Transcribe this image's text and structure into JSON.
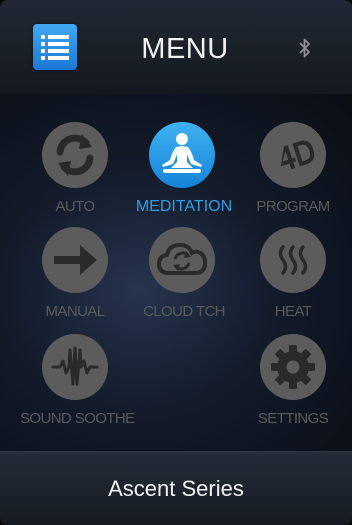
{
  "header": {
    "title": "MENU",
    "menu_icon": "list-menu-icon",
    "status_icon": "bluetooth-icon"
  },
  "menu": {
    "items": [
      {
        "label": "AUTO",
        "icon": "auto-sync-icon",
        "active": false
      },
      {
        "label": "MEDITATION",
        "icon": "meditation-icon",
        "active": true
      },
      {
        "label": "PROGRAM",
        "icon": "4d-program-icon",
        "active": false
      },
      {
        "label": "MANUAL",
        "icon": "arrow-right-icon",
        "active": false
      },
      {
        "label": "CLOUD TCH",
        "icon": "cloud-sync-icon",
        "active": false
      },
      {
        "label": "HEAT",
        "icon": "heat-waves-icon",
        "active": false
      },
      {
        "label": "SOUND SOOTHE",
        "icon": "sound-wave-icon",
        "active": false
      },
      {
        "label": "SETTINGS",
        "icon": "gear-icon",
        "active": false
      }
    ]
  },
  "footer": {
    "title": "Ascent Series"
  },
  "colors": {
    "accent": "#2e9fe6",
    "inactive": "#5c5c5c",
    "background": "#0b0f18"
  }
}
